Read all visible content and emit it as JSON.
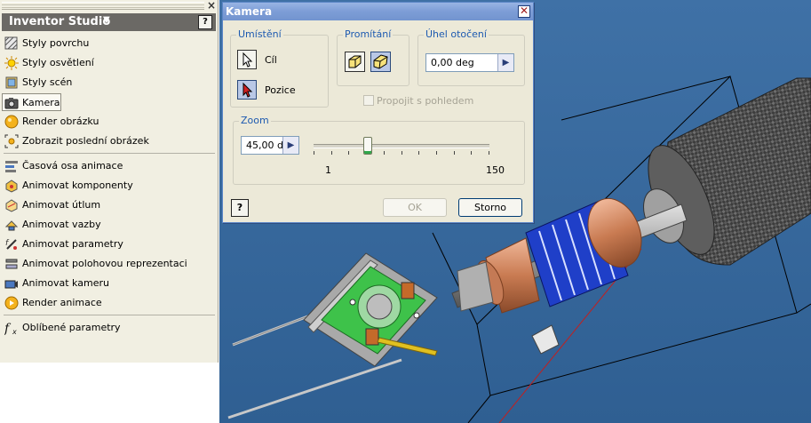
{
  "panel": {
    "title": "Inventor Studio",
    "items": [
      {
        "label": "Styly povrchu",
        "icon": "surface-style-icon"
      },
      {
        "label": "Styly osvětlení",
        "icon": "lighting-style-icon"
      },
      {
        "label": "Styly scén",
        "icon": "scene-style-icon"
      },
      {
        "label": "Kamera",
        "icon": "camera-icon",
        "active": true
      },
      {
        "label": "Render obrázku",
        "icon": "render-image-icon"
      },
      {
        "label": "Zobrazit poslední obrázek",
        "icon": "show-last-image-icon"
      },
      {
        "label": "Časová osa animace",
        "icon": "animation-timeline-icon"
      },
      {
        "label": "Animovat komponenty",
        "icon": "animate-components-icon"
      },
      {
        "label": "Animovat útlum",
        "icon": "animate-fade-icon"
      },
      {
        "label": "Animovat vazby",
        "icon": "animate-constraints-icon"
      },
      {
        "label": "Animovat parametry",
        "icon": "animate-parameters-icon"
      },
      {
        "label": "Animovat polohovou reprezentaci",
        "icon": "animate-positional-rep-icon"
      },
      {
        "label": "Animovat kameru",
        "icon": "animate-camera-icon"
      },
      {
        "label": "Render animace",
        "icon": "render-animation-icon"
      },
      {
        "label": "Oblíbené parametry",
        "icon": "favorite-parameters-icon"
      }
    ]
  },
  "dialog": {
    "title": "Kamera",
    "placement": {
      "label": "Umístění",
      "target": "Cíl",
      "position": "Pozice"
    },
    "projection": {
      "label": "Promítání"
    },
    "rotation": {
      "label": "Úhel otočení",
      "value": "0,00 deg"
    },
    "link_view": "Propojit s pohledem",
    "zoom": {
      "label": "Zoom",
      "value": "45,00 d",
      "min": "1",
      "max": "150",
      "slider_fraction": 0.31
    },
    "ok": "OK",
    "cancel": "Storno"
  },
  "colors": {
    "viewport_bg": "#3a6ca0",
    "dialog_title": "#7d9dd6",
    "panel_header": "#6b6965",
    "group_label": "#1d5ab0"
  }
}
